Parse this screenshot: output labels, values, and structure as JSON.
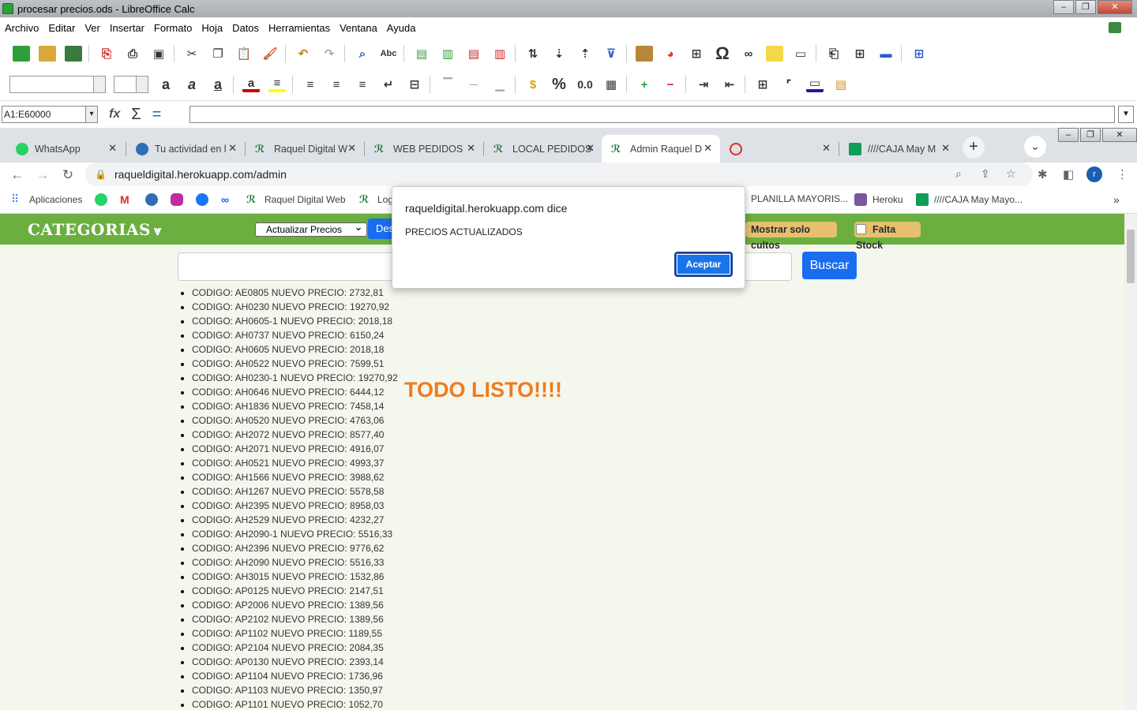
{
  "libreoffice": {
    "window_title": "procesar precios.ods - LibreOffice Calc",
    "menu": [
      "Archivo",
      "Editar",
      "Ver",
      "Insertar",
      "Formato",
      "Hoja",
      "Datos",
      "Herramientas",
      "Ventana",
      "Ayuda"
    ],
    "name_box": "A1:E60000",
    "toolbar_glyphs": {
      "special_char": "Ω",
      "percent": "%",
      "decimal": "0.0",
      "bold": "a",
      "italic": "a",
      "underline": "a"
    }
  },
  "chrome": {
    "tabs": [
      {
        "label": "WhatsApp",
        "icon": "whatsapp-icon",
        "color": "#25d366"
      },
      {
        "label": "Tu actividad en l",
        "icon": "mercadolibre-icon",
        "color": "#2d6fb4"
      },
      {
        "label": "Raquel Digital W",
        "icon": "raquel-logo-icon",
        "color": "#1e7a3c"
      },
      {
        "label": "WEB PEDIDOS",
        "icon": "raquel-logo-icon",
        "color": "#1e7a3c"
      },
      {
        "label": "LOCAL PEDIDOS",
        "icon": "raquel-logo-icon",
        "color": "#1e7a3c"
      },
      {
        "label": "Admin Raquel D",
        "icon": "raquel-logo-icon",
        "color": "#1e7a3c",
        "active": true
      },
      {
        "label": "",
        "icon": "red-circle-icon",
        "color": "#d93025"
      },
      {
        "label": "////CAJA May M",
        "icon": "sheets-icon",
        "color": "#0f9d58"
      }
    ],
    "url": "raqueldigital.herokuapp.com/admin",
    "profile_initial": "r",
    "bookmarks": [
      {
        "label": "Aplicaciones",
        "icon": "apps-grid-icon"
      },
      {
        "label": "",
        "icon": "whatsapp-icon"
      },
      {
        "label": "",
        "icon": "gmail-icon"
      },
      {
        "label": "",
        "icon": "mercadolibre-icon"
      },
      {
        "label": "",
        "icon": "instagram-icon"
      },
      {
        "label": "",
        "icon": "facebook-icon"
      },
      {
        "label": "",
        "icon": "meta-icon"
      },
      {
        "label": "Raquel Digital Web",
        "icon": "raquel-logo-icon"
      },
      {
        "label": "Log",
        "icon": "raquel-logo-icon"
      },
      {
        "label": "PLANILLA MAYORIS...",
        "icon": "sheet-icon"
      },
      {
        "label": "Heroku",
        "icon": "heroku-icon"
      },
      {
        "label": "////CAJA May Mayo...",
        "icon": "sheets-icon"
      }
    ],
    "bookmarks_overflow": "»"
  },
  "admin": {
    "categories_title": "CATEGORIAS",
    "action_select": "Actualizar Precios",
    "des_button": "Des",
    "show_cults": "Mostrar solo cultos",
    "missing_stock": "Falta Stock",
    "search_placeholder": "",
    "search_button": "Buscar",
    "done_text": "TODO LISTO!!!!",
    "accent_green": "#6aaf3f",
    "items": [
      "CODIGO: AE0805 NUEVO PRECIO: 2732,81",
      "CODIGO: AH0230 NUEVO PRECIO: 19270,92",
      "CODIGO: AH0605-1 NUEVO PRECIO: 2018,18",
      "CODIGO: AH0737 NUEVO PRECIO: 6150,24",
      "CODIGO: AH0605 NUEVO PRECIO: 2018,18",
      "CODIGO: AH0522 NUEVO PRECIO: 7599,51",
      "CODIGO: AH0230-1 NUEVO PRECIO: 19270,92",
      "CODIGO: AH0646 NUEVO PRECIO: 6444,12",
      "CODIGO: AH1836 NUEVO PRECIO: 7458,14",
      "CODIGO: AH0520 NUEVO PRECIO: 4763,06",
      "CODIGO: AH2072 NUEVO PRECIO: 8577,40",
      "CODIGO: AH2071 NUEVO PRECIO: 4916,07",
      "CODIGO: AH0521 NUEVO PRECIO: 4993,37",
      "CODIGO: AH1566 NUEVO PRECIO: 3988,62",
      "CODIGO: AH1267 NUEVO PRECIO: 5578,58",
      "CODIGO: AH2395 NUEVO PRECIO: 8958,03",
      "CODIGO: AH2529 NUEVO PRECIO: 4232,27",
      "CODIGO: AH2090-1 NUEVO PRECIO: 5516,33",
      "CODIGO: AH2396 NUEVO PRECIO: 9776,62",
      "CODIGO: AH2090 NUEVO PRECIO: 5516,33",
      "CODIGO: AH3015 NUEVO PRECIO: 1532,86",
      "CODIGO: AP0125 NUEVO PRECIO: 2147,51",
      "CODIGO: AP2006 NUEVO PRECIO: 1389,56",
      "CODIGO: AP2102 NUEVO PRECIO: 1389,56",
      "CODIGO: AP1102 NUEVO PRECIO: 1189,55",
      "CODIGO: AP2104 NUEVO PRECIO: 2084,35",
      "CODIGO: AP0130 NUEVO PRECIO: 2393,14",
      "CODIGO: AP1104 NUEVO PRECIO: 1736,96",
      "CODIGO: AP1103 NUEVO PRECIO: 1350,97",
      "CODIGO: AP1101 NUEVO PRECIO: 1052,70"
    ]
  },
  "dialog": {
    "title": "raqueldigital.herokuapp.com dice",
    "message": "PRECIOS ACTUALIZADOS",
    "ok_label": "Aceptar"
  }
}
